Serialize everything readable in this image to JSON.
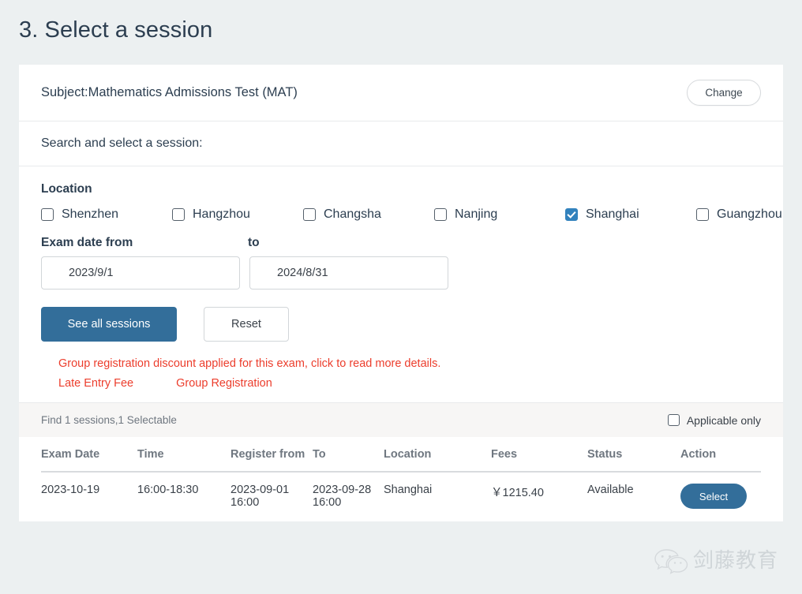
{
  "page": {
    "title": "3. Select a session",
    "background_color": "#ecf0f1"
  },
  "subject": {
    "text": "Subject:Mathematics Admissions Test (MAT)",
    "change_label": "Change"
  },
  "search": {
    "prompt": "Search and select a session:"
  },
  "filters": {
    "location_label": "Location",
    "locations": [
      {
        "label": "Shenzhen",
        "checked": false
      },
      {
        "label": "Hangzhou",
        "checked": false
      },
      {
        "label": "Changsha",
        "checked": false
      },
      {
        "label": "Nanjing",
        "checked": false
      },
      {
        "label": "Shanghai",
        "checked": true
      },
      {
        "label": "Guangzhou",
        "checked": false
      }
    ],
    "date_from_label": "Exam date from",
    "date_to_label": "to",
    "date_from_value": "2023/9/1",
    "date_to_value": "2024/8/31",
    "see_all_label": "See all sessions",
    "reset_label": "Reset"
  },
  "notices": {
    "discount": "Group registration discount applied for this exam, click to read more details.",
    "link_late_entry": "Late Entry Fee",
    "link_group_registration": "Group Registration",
    "color": "#ec3d2c"
  },
  "results": {
    "count_text": "Find 1 sessions,1 Selectable",
    "applicable_only_label": "Applicable only",
    "applicable_only_checked": false
  },
  "table": {
    "headers": {
      "exam_date": "Exam Date",
      "time": "Time",
      "register_from": "Register from",
      "to": "To",
      "location": "Location",
      "fees": "Fees",
      "status": "Status",
      "action": "Action"
    },
    "rows": [
      {
        "exam_date": "2023-10-19",
        "time": "16:00-18:30",
        "register_from": "2023-09-01 16:00",
        "to": "2023-09-28 16:00",
        "location": "Shanghai",
        "fees": "￥1215.40",
        "status": "Available",
        "status_color": "#5aa35a",
        "action_label": "Select"
      }
    ]
  },
  "watermark": {
    "text": "剑藤教育",
    "icon": "wechat-icon"
  },
  "theme": {
    "primary_blue": "#336e9a",
    "checkbox_blue": "#3282bd",
    "text_dark": "#2c3e50",
    "muted": "#6f7780"
  }
}
